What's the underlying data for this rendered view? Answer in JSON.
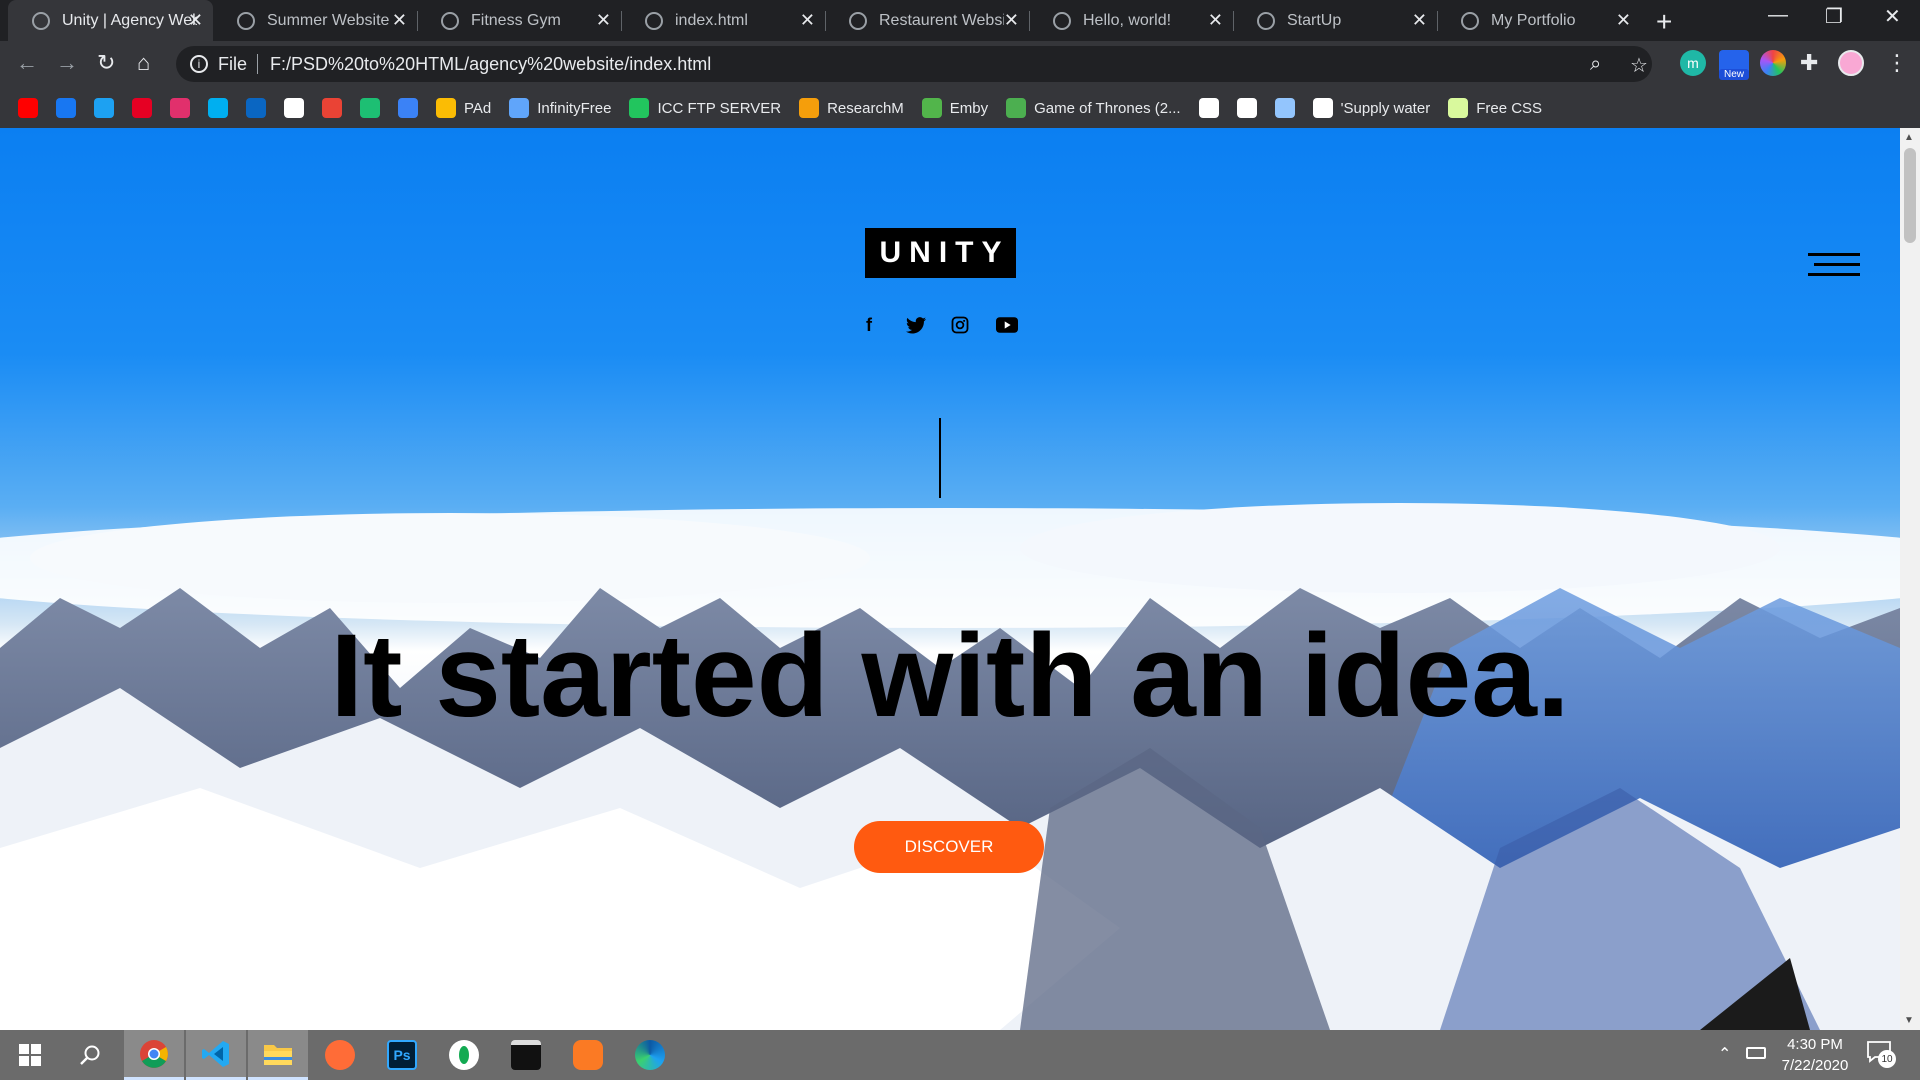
{
  "browser": {
    "tabs": [
      {
        "title": "Unity | Agency Website",
        "active": true
      },
      {
        "title": "Summer Website",
        "active": false
      },
      {
        "title": "Fitness Gym",
        "active": false
      },
      {
        "title": "index.html",
        "active": false
      },
      {
        "title": "Restaurent Website",
        "active": false
      },
      {
        "title": "Hello, world!",
        "active": false
      },
      {
        "title": "StartUp",
        "active": false
      },
      {
        "title": "My Portfolio",
        "active": false
      }
    ],
    "address": {
      "scheme": "File",
      "url": "F:/PSD%20to%20HTML/agency%20website/index.html"
    },
    "extension_badge": "New",
    "bookmarks": [
      {
        "label": "",
        "icon": "youtube-icon",
        "color": "#ff0000"
      },
      {
        "label": "",
        "icon": "facebook-icon",
        "color": "#1877f2"
      },
      {
        "label": "",
        "icon": "twitter-icon",
        "color": "#1da1f2"
      },
      {
        "label": "",
        "icon": "pinterest-icon",
        "color": "#e60023"
      },
      {
        "label": "",
        "icon": "instagram-icon",
        "color": "#e1306c"
      },
      {
        "label": "",
        "icon": "skype-icon",
        "color": "#00aff0"
      },
      {
        "label": "",
        "icon": "linkedin-icon",
        "color": "#0a66c2"
      },
      {
        "label": "",
        "icon": "github-icon",
        "color": "#ffffff"
      },
      {
        "label": "",
        "icon": "gmail-icon",
        "color": "#ea4335"
      },
      {
        "label": "",
        "icon": "fiverr-icon",
        "color": "#1dbf73"
      },
      {
        "label": "",
        "icon": "canva-icon",
        "color": "#3b82f6"
      },
      {
        "label": "PAd",
        "icon": "drive-icon",
        "color": "#fbbc04"
      },
      {
        "label": "InfinityFree",
        "icon": "infinity-icon",
        "color": "#60a5fa"
      },
      {
        "label": "ICC FTP SERVER",
        "icon": "feather-icon",
        "color": "#22c55e"
      },
      {
        "label": "ResearchM",
        "icon": "research-icon",
        "color": "#f59e0b"
      },
      {
        "label": "Emby",
        "icon": "emby-icon",
        "color": "#52b54b"
      },
      {
        "label": "Game of Thrones (2...",
        "icon": "got-icon",
        "color": "#4caf50"
      },
      {
        "label": "",
        "icon": "news-icon",
        "color": "#ffffff"
      },
      {
        "label": "",
        "icon": "shazam-icon",
        "color": "#ffffff"
      },
      {
        "label": "",
        "icon": "loop-icon",
        "color": "#93c5fd"
      },
      {
        "label": "'Supply water",
        "icon": "doc-icon",
        "color": "#ffffff"
      },
      {
        "label": "Free CSS",
        "icon": "freecss-icon",
        "color": "#d9f99d"
      }
    ]
  },
  "page": {
    "logo": "UNITY",
    "social": [
      "facebook-icon",
      "twitter-icon",
      "instagram-icon",
      "youtube-icon"
    ],
    "headline": "It started with an idea.",
    "cta": "DISCOVER",
    "accent": "#ff5a10"
  },
  "taskbar": {
    "apps": [
      "windows-start-icon",
      "search-icon",
      "chrome-icon",
      "vscode-icon",
      "file-explorer-icon",
      "postman-icon",
      "photoshop-icon",
      "mongodb-icon",
      "terminal-icon",
      "xampp-icon",
      "edge-icon"
    ],
    "time": "4:30 PM",
    "date": "7/22/2020",
    "notification_count": "10"
  }
}
